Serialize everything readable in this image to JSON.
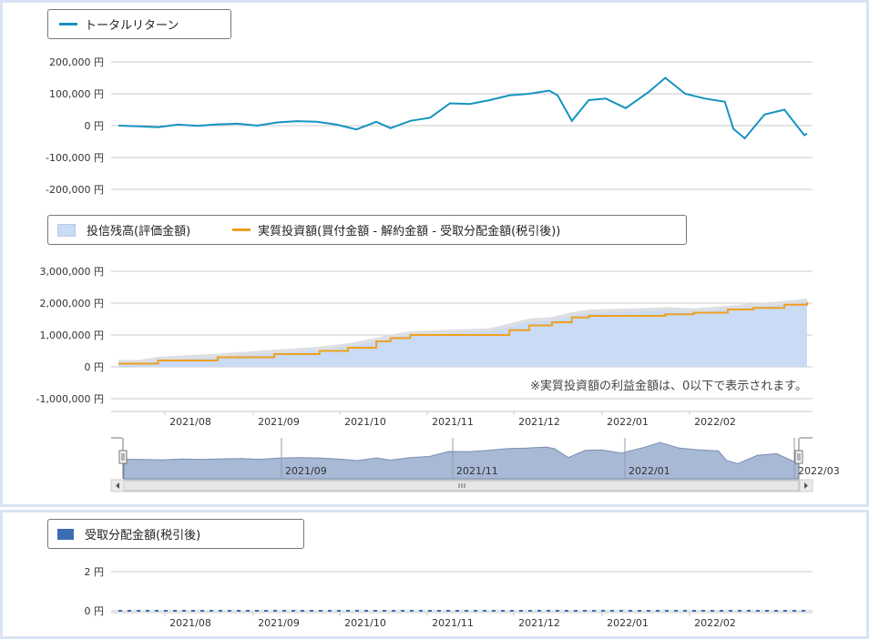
{
  "colors": {
    "total_return": "#1593c0",
    "balance_fill": "#c9dbf5",
    "net_invest": "#f0a020",
    "dist_bar": "#3b6db4",
    "navigator_fill": "#a8b9d6",
    "grid": "#c8c8c8",
    "panel_border": "#d9e3f5"
  },
  "chart_data": [
    {
      "type": "line",
      "legend": [
        "トータルリターン"
      ],
      "yticks": [
        "200,000 円",
        "100,000 円",
        "0 円",
        "-100,000 円",
        "-200,000 円"
      ],
      "ylim": [
        -200000,
        200000
      ],
      "x_range": [
        "2021-07-01",
        "2022-03-01"
      ],
      "series": [
        {
          "name": "トータルリターン",
          "x": [
            "2021-07-01",
            "2021-07-08",
            "2021-07-15",
            "2021-07-22",
            "2021-07-29",
            "2021-08-05",
            "2021-08-12",
            "2021-08-19",
            "2021-08-26",
            "2021-09-02",
            "2021-09-09",
            "2021-09-16",
            "2021-09-23",
            "2021-09-30",
            "2021-10-05",
            "2021-10-12",
            "2021-10-19",
            "2021-10-26",
            "2021-11-02",
            "2021-11-09",
            "2021-11-16",
            "2021-11-23",
            "2021-11-30",
            "2021-12-03",
            "2021-12-08",
            "2021-12-14",
            "2021-12-20",
            "2021-12-27",
            "2022-01-04",
            "2022-01-10",
            "2022-01-17",
            "2022-01-24",
            "2022-01-31",
            "2022-02-03",
            "2022-02-07",
            "2022-02-14",
            "2022-02-21",
            "2022-02-28",
            "2022-03-01"
          ],
          "values": [
            0,
            -2000,
            -5000,
            3000,
            -1000,
            4000,
            6000,
            0,
            10000,
            14000,
            12000,
            3000,
            -12000,
            12000,
            -8000,
            15000,
            25000,
            70000,
            68000,
            80000,
            95000,
            100000,
            110000,
            95000,
            15000,
            80000,
            85000,
            55000,
            105000,
            150000,
            100000,
            85000,
            75000,
            -10000,
            -40000,
            35000,
            50000,
            -30000,
            -25000
          ]
        }
      ]
    },
    {
      "type": "area",
      "legend": [
        "投信残高(評価金額)",
        "実質投資額(買付金額 - 解約金額 - 受取分配金額(税引後))"
      ],
      "yticks": [
        "3,000,000 円",
        "2,000,000 円",
        "1,000,000 円",
        "0 円",
        "-1,000,000 円"
      ],
      "ylim": [
        -1000000,
        3000000
      ],
      "xticks": [
        "2021/08",
        "2021/09",
        "2021/10",
        "2021/11",
        "2021/12",
        "2022/01",
        "2022/02"
      ],
      "note": "※実質投資額の利益金額は、0以下で表示されます。",
      "series": [
        {
          "name": "投信残高(評価金額)",
          "x": [
            "2021-07-01",
            "2021-07-08",
            "2021-07-15",
            "2021-08-05",
            "2021-08-25",
            "2021-09-10",
            "2021-09-20",
            "2021-09-30",
            "2021-10-05",
            "2021-10-12",
            "2021-10-19",
            "2021-10-26",
            "2021-11-09",
            "2021-11-16",
            "2021-11-23",
            "2021-12-01",
            "2021-12-08",
            "2021-12-14",
            "2021-12-20",
            "2022-01-04",
            "2022-01-10",
            "2022-01-20",
            "2022-02-01",
            "2022-02-10",
            "2022-02-21",
            "2022-03-01"
          ],
          "values": [
            100000,
            100000,
            200000,
            300000,
            420000,
            520000,
            620000,
            800000,
            900000,
            1000000,
            1020000,
            1050000,
            1100000,
            1250000,
            1400000,
            1450000,
            1600000,
            1680000,
            1700000,
            1730000,
            1760000,
            1720000,
            1800000,
            1880000,
            1950000,
            2030000
          ]
        },
        {
          "name": "実質投資額(買付金額 - 解約金額 - 受取分配金額(税引後))",
          "x": [
            "2021-07-01",
            "2021-07-08",
            "2021-07-15",
            "2021-08-05",
            "2021-08-25",
            "2021-09-10",
            "2021-09-20",
            "2021-09-30",
            "2021-10-05",
            "2021-10-12",
            "2021-10-19",
            "2021-10-26",
            "2021-11-09",
            "2021-11-16",
            "2021-11-23",
            "2021-12-01",
            "2021-12-08",
            "2021-12-14",
            "2021-12-20",
            "2022-01-04",
            "2022-01-10",
            "2022-01-20",
            "2022-02-01",
            "2022-02-10",
            "2022-02-21",
            "2022-03-01"
          ],
          "values": [
            100000,
            100000,
            200000,
            300000,
            400000,
            500000,
            600000,
            800000,
            900000,
            1000000,
            1000000,
            1000000,
            1000000,
            1150000,
            1300000,
            1400000,
            1550000,
            1600000,
            1600000,
            1600000,
            1650000,
            1700000,
            1800000,
            1850000,
            1950000,
            2030000
          ]
        }
      ]
    },
    {
      "type": "area",
      "role": "navigator",
      "xticks": [
        "2021/09",
        "2021/11",
        "2022/01",
        "2022/03"
      ]
    },
    {
      "type": "bar",
      "legend": [
        "受取分配金額(税引後)"
      ],
      "yticks": [
        "2 円",
        "0 円"
      ],
      "ylim": [
        0,
        2
      ],
      "xticks": [
        "2021/08",
        "2021/09",
        "2021/10",
        "2021/11",
        "2021/12",
        "2022/01",
        "2022/02"
      ],
      "series": [
        {
          "name": "受取分配金額(税引後)",
          "values": [
            0
          ]
        }
      ]
    }
  ]
}
